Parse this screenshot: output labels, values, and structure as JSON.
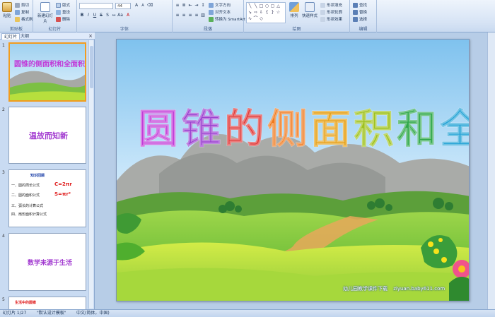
{
  "ribbon": {
    "clipboard": {
      "label": "剪贴板",
      "paste": "粘贴",
      "cut": "剪切",
      "copy": "复制",
      "format_painter": "格式刷"
    },
    "slides": {
      "label": "幻灯片",
      "new_slide": "新建幻灯片",
      "layout": "版式",
      "reset": "重设",
      "delete": "删除"
    },
    "font": {
      "label": "字体",
      "font_size": "44"
    },
    "paragraph": {
      "label": "段落",
      "text_direction": "文字方向",
      "align_text": "对齐文本",
      "smartart": "转换为 SmartArt"
    },
    "drawing": {
      "label": "绘图",
      "arrange": "排列",
      "quick_styles": "快速样式",
      "shape_fill": "形状填充",
      "shape_outline": "形状轮廓",
      "shape_effects": "形状效果"
    },
    "editing": {
      "label": "编辑",
      "find": "查找",
      "replace": "替换",
      "select": "选择"
    }
  },
  "left_panel": {
    "tabs": [
      "幻灯片",
      "大纲"
    ],
    "thumbnails": [
      {
        "num": "1",
        "title": "圆锥的侧面积和全面积"
      },
      {
        "num": "2",
        "title": "温故而知新"
      },
      {
        "num": "3",
        "heading": "知识回顾",
        "lines": [
          "一、圆的周长公式",
          "二、圆的面积公式",
          "三、弧长的计算公式",
          "四、扇形面积计算公式"
        ],
        "formula1": "C=2πr",
        "formula2": "S=πr²"
      },
      {
        "num": "4",
        "title": "数学来源于生活"
      },
      {
        "num": "5",
        "title": "生活中的圆锥"
      }
    ]
  },
  "slide": {
    "title_chars": [
      "圆",
      "锥",
      "的",
      "侧",
      "面",
      "积",
      "和",
      "全",
      "面",
      "积"
    ],
    "footer_left": "幼儿园教学课件下载",
    "footer_right": "ziyuan.baby611.com"
  },
  "status_bar": {
    "slide_counter": "幻灯片 1/27",
    "theme": "\"默认设计模板\"",
    "language": "中文(简体，中国)"
  },
  "colors": {
    "ribbon_bg": "#d7e4f5",
    "selection_border": "#f29c1f",
    "title_gradient": [
      "#c23bd8",
      "#9b3fd0",
      "#e03a3a",
      "#f07a1e",
      "#e6a21a",
      "#9ec21d",
      "#2fa84a",
      "#25a3d6",
      "#2b5fd9",
      "#6b2fc9"
    ]
  }
}
